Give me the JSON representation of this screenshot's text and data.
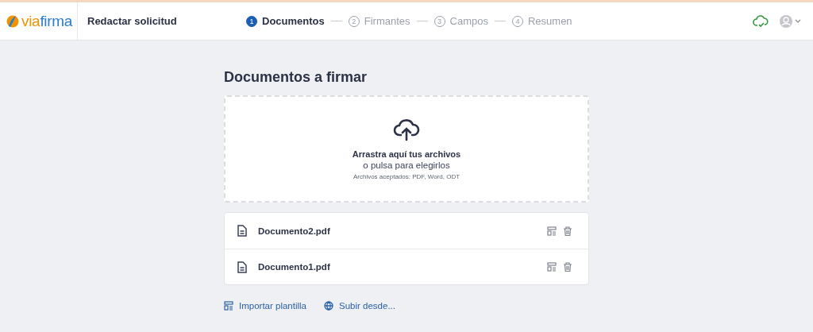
{
  "header": {
    "logo": {
      "prefix": "via",
      "name": "firma"
    },
    "title": "Redactar solicitud",
    "steps": [
      {
        "number": "1",
        "label": "Documentos",
        "selected": true
      },
      {
        "number": "2",
        "label": "Firmantes",
        "selected": false
      },
      {
        "number": "3",
        "label": "Campos",
        "selected": false
      },
      {
        "number": "4",
        "label": "Resumen",
        "selected": false
      }
    ]
  },
  "page": {
    "heading": "Documentos a firmar",
    "dropzone": {
      "title": "Arrastra aquí tus archivos",
      "subtitle": "o pulsa para elegirlos",
      "hint": "Archivos aceptados: PDF, Word, ODT"
    },
    "documents": [
      {
        "name": "Documento2.pdf"
      },
      {
        "name": "Documento1.pdf"
      }
    ],
    "actions": [
      {
        "kind": "template",
        "label": "Importar plantilla"
      },
      {
        "kind": "globe",
        "label": "Subir desde..."
      }
    ]
  }
}
